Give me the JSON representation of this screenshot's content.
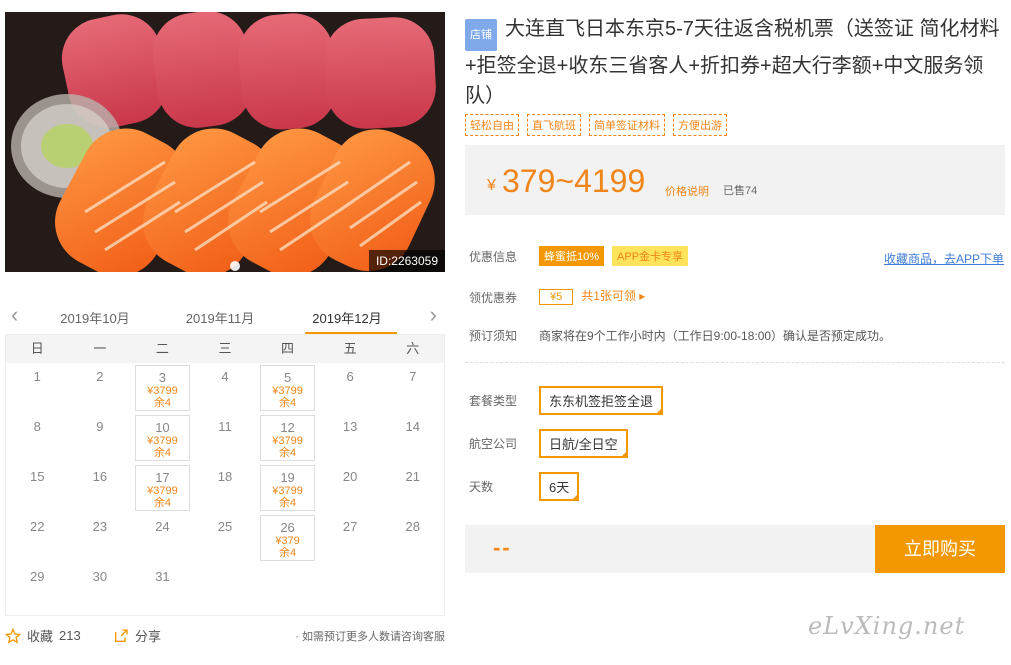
{
  "image": {
    "id_label": "ID:2263059"
  },
  "calendar": {
    "months": [
      "2019年10月",
      "2019年11月",
      "2019年12月"
    ],
    "weekdays": [
      "日",
      "一",
      "二",
      "三",
      "四",
      "五",
      "六"
    ],
    "days": [
      {
        "d": "1"
      },
      {
        "d": "2"
      },
      {
        "d": "3",
        "price": "¥3799",
        "left": "余4"
      },
      {
        "d": "4"
      },
      {
        "d": "5",
        "price": "¥3799",
        "left": "余4"
      },
      {
        "d": "6"
      },
      {
        "d": "7"
      },
      {
        "d": "8"
      },
      {
        "d": "9"
      },
      {
        "d": "10",
        "price": "¥3799",
        "left": "余4"
      },
      {
        "d": "11"
      },
      {
        "d": "12",
        "price": "¥3799",
        "left": "余4"
      },
      {
        "d": "13"
      },
      {
        "d": "14"
      },
      {
        "d": "15"
      },
      {
        "d": "16"
      },
      {
        "d": "17",
        "price": "¥3799",
        "left": "余4"
      },
      {
        "d": "18"
      },
      {
        "d": "19",
        "price": "¥3799",
        "left": "余4"
      },
      {
        "d": "20"
      },
      {
        "d": "21"
      },
      {
        "d": "22"
      },
      {
        "d": "23"
      },
      {
        "d": "24"
      },
      {
        "d": "25"
      },
      {
        "d": "26",
        "price": "¥379",
        "left": "余4"
      },
      {
        "d": "27"
      },
      {
        "d": "28"
      },
      {
        "d": "29"
      },
      {
        "d": "30"
      },
      {
        "d": "31"
      }
    ]
  },
  "actions": {
    "favorite_label": "收藏",
    "favorite_count": "213",
    "share_label": "分享",
    "note": "· 如需预订更多人数请咨询客服"
  },
  "product": {
    "shop_badge": "店铺",
    "title": "大连直飞日本东京5-7天往返含税机票（送签证 简化材料+拒签全退+收东三省客人+折扣券+超大行李额+中文服务领队）",
    "tags": [
      "轻松自由",
      "直飞航班",
      "简单签证材料",
      "方便出游"
    ],
    "currency": "¥",
    "price_range": "379~4199",
    "price_explain": "价格说明",
    "sold": "已售74"
  },
  "promo": {
    "label": "优惠信息",
    "discount": "蜂蜜抵10%",
    "app_badge": "APP金卡专享",
    "collect_link": "收藏商品，去APP下单"
  },
  "coupon": {
    "label": "领优惠券",
    "amount": "¥5",
    "text": "共1张可领 ▸"
  },
  "booking_note": {
    "label": "预订须知",
    "text": "商家将在9个工作小时内（工作日9:00-18:00）确认是否预定成功。"
  },
  "options": {
    "package_label": "套餐类型",
    "package_value": "东东机签拒签全退",
    "airline_label": "航空公司",
    "airline_value": "日航/全日空",
    "days_label": "天数",
    "days_value": "6天"
  },
  "buy": {
    "total": "--",
    "button": "立即购买"
  },
  "watermark": "eLvXing.net",
  "colors": {
    "accent": "#f39800",
    "price": "#f08519",
    "link": "#3f7bd6"
  }
}
